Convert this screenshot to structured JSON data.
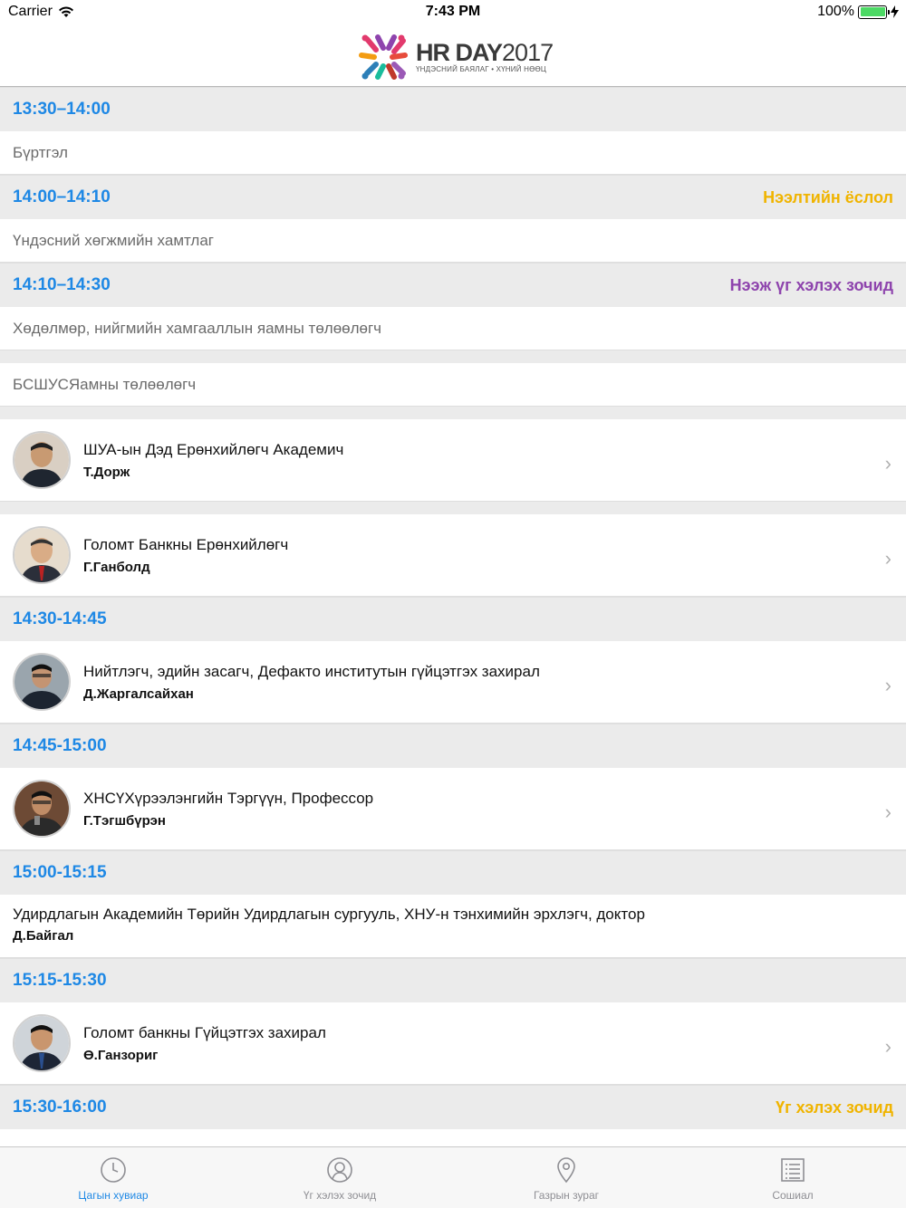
{
  "status": {
    "carrier": "Carrier",
    "time": "7:43 PM",
    "battery": "100%",
    "battery_level": 1.0
  },
  "header": {
    "logo_title_bold": "HR DAY",
    "logo_title_year": "2017",
    "logo_subtitle": "ҮНДЭСНИЙ БАЯЛАГ • ХҮНИЙ НӨӨЦ"
  },
  "colors": {
    "accent": "#1e88e5",
    "opening_tag": "#f0b400",
    "keynote_tag": "#8e44ad",
    "speaker_tag": "#f0b400"
  },
  "schedule": {
    "s1": {
      "time": "13:30–14:00",
      "row1": "Бүртгэл"
    },
    "s2": {
      "time": "14:00–14:10",
      "tag": "Нээлтийн ёслол",
      "row1": "Үндэсний хөгжмийн хамтлаг"
    },
    "s3": {
      "time": "14:10–14:30",
      "tag": "Нээж үг хэлэх зочид",
      "row1": "Хөдөлмөр, нийгмийн хамгааллын яамны төлөөлөгч",
      "row2": "БСШУСЯамны төлөөлөгч",
      "speakers": [
        {
          "title": "ШУА-ын Дэд Ерөнхийлөгч Академич",
          "name": "Т.Дорж"
        },
        {
          "title": "Голомт Банкны Ерөнхийлөгч",
          "name": "Г.Ганболд"
        }
      ]
    },
    "s4": {
      "time": "14:30-14:45",
      "speaker": {
        "title": "Нийтлэгч, эдийн засагч, Дефакто институтын гүйцэтгэх захирал",
        "name": "Д.Жаргалсайхан"
      }
    },
    "s5": {
      "time": "14:45-15:00",
      "speaker": {
        "title": "ХНСҮХүрээлэнгийн Тэргүүн, Профессор",
        "name": "Г.Тэгшбүрэн"
      }
    },
    "s6": {
      "time": "15:00-15:15",
      "speaker": {
        "title": "Удирдлагын Академийн Төрийн Удирдлагын сургууль, ХНУ-н тэнхимийн эрхлэгч, доктор",
        "name": "Д.Байгал"
      }
    },
    "s7": {
      "time": "15:15-15:30",
      "speaker": {
        "title": "Голомт банкны Гүйцэтгэх захирал",
        "name": "Ө.Ганзориг"
      }
    },
    "s8": {
      "time": "15:30-16:00",
      "tag": "Үг хэлэх зочид"
    }
  },
  "tabs": [
    {
      "label": "Цагын хувиар",
      "icon": "clock-icon",
      "active": true
    },
    {
      "label": "Үг хэлэх зочид",
      "icon": "user-icon",
      "active": false
    },
    {
      "label": "Газрын зураг",
      "icon": "map-pin-icon",
      "active": false
    },
    {
      "label": "Сошиал",
      "icon": "list-icon",
      "active": false
    }
  ]
}
